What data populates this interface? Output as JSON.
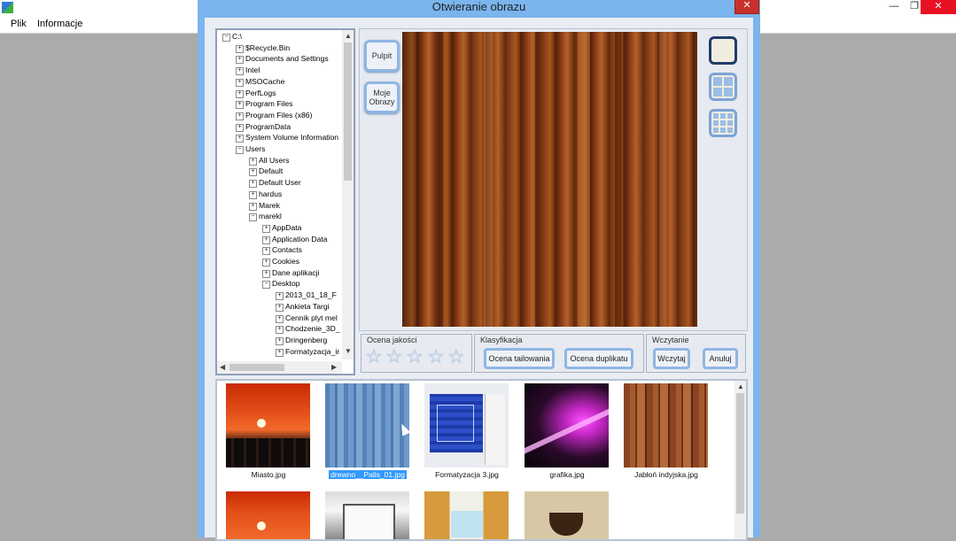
{
  "app": {
    "menu": [
      "Plik",
      "Informacje"
    ],
    "controls": {
      "minimize": "—",
      "restore": "❐",
      "close": "✕"
    }
  },
  "dialog": {
    "title": "Otwieranie obrazu",
    "close": "✕",
    "tree": {
      "items": [
        {
          "label": "C:\\",
          "level": 0,
          "expanded": true
        },
        {
          "label": "$Recycle.Bin",
          "level": 1
        },
        {
          "label": "Documents and Settings",
          "level": 1
        },
        {
          "label": "Intel",
          "level": 1
        },
        {
          "label": "MSOCache",
          "level": 1
        },
        {
          "label": "PerfLogs",
          "level": 1
        },
        {
          "label": "Program Files",
          "level": 1
        },
        {
          "label": "Program Files (x86)",
          "level": 1
        },
        {
          "label": "ProgramData",
          "level": 1
        },
        {
          "label": "System Volume Information",
          "level": 1
        },
        {
          "label": "Users",
          "level": 1,
          "expanded": true
        },
        {
          "label": "All Users",
          "level": 2
        },
        {
          "label": "Default",
          "level": 2
        },
        {
          "label": "Default User",
          "level": 2
        },
        {
          "label": "hardus",
          "level": 2
        },
        {
          "label": "Marek",
          "level": 2
        },
        {
          "label": "marekl",
          "level": 2,
          "expanded": true
        },
        {
          "label": "AppData",
          "level": 3
        },
        {
          "label": "Application Data",
          "level": 3
        },
        {
          "label": "Contacts",
          "level": 3
        },
        {
          "label": "Cookies",
          "level": 3
        },
        {
          "label": "Dane aplikacji",
          "level": 3
        },
        {
          "label": "Desktop",
          "level": 3,
          "expanded": true
        },
        {
          "label": "2013_01_18_F",
          "level": 4
        },
        {
          "label": "Ankieta Targi",
          "level": 4
        },
        {
          "label": "Cennik plyt mel",
          "level": 4
        },
        {
          "label": "Chodzenie_3D_",
          "level": 4
        },
        {
          "label": "Dringenberg",
          "level": 4
        },
        {
          "label": "Formatyzacja_ir",
          "level": 4
        }
      ]
    },
    "shortcuts": {
      "desktop": "Pulpit",
      "pictures_line1": "Moje",
      "pictures_line2": "Obrazy"
    },
    "view_modes": [
      "single-view-icon",
      "grid-2x2-icon",
      "grid-3x3-icon"
    ],
    "quality": {
      "label": "Ocena jakości",
      "stars": 5
    },
    "classification": {
      "label": "Klasyfikacja",
      "tiling": "Ocena tailowania",
      "duplicate": "Ocena duplikatu"
    },
    "loading": {
      "label": "Wczytanie",
      "load": "Wczytaj",
      "cancel": "Anuluj"
    },
    "files": [
      {
        "name": "Miasto.jpg",
        "selected": false
      },
      {
        "name": "drewno__Palis_01.jpg",
        "selected": true
      },
      {
        "name": "Formatyzacja 3.jpg",
        "selected": false
      },
      {
        "name": "grafika.jpg",
        "selected": false
      },
      {
        "name": "Jabłoń indyjska.jpg",
        "selected": false
      }
    ],
    "accent": "#7ab5ee",
    "selection_color": "#3399ff"
  }
}
